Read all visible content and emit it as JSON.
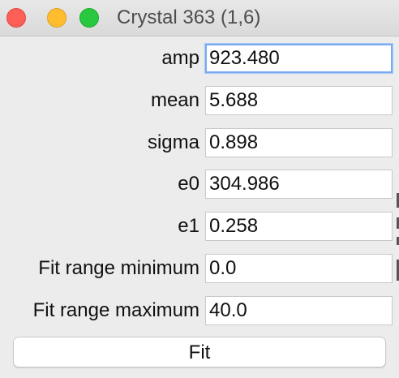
{
  "window": {
    "title": "Crystal 363 (1,6)"
  },
  "form": {
    "fields": [
      {
        "label": "amp",
        "value": "923.480",
        "focused": true
      },
      {
        "label": "mean",
        "value": "5.688"
      },
      {
        "label": "sigma",
        "value": "0.898"
      },
      {
        "label": "e0",
        "value": "304.986"
      },
      {
        "label": "e1",
        "value": "0.258"
      },
      {
        "label": "Fit range minimum",
        "value": "0.0"
      },
      {
        "label": "Fit range maximum",
        "value": "40.0"
      }
    ],
    "fit_button_label": "Fit"
  },
  "colors": {
    "close": "#fe5f57",
    "minimize": "#febc2e",
    "zoom": "#28c840",
    "focus_ring": "#7aaaf0"
  }
}
